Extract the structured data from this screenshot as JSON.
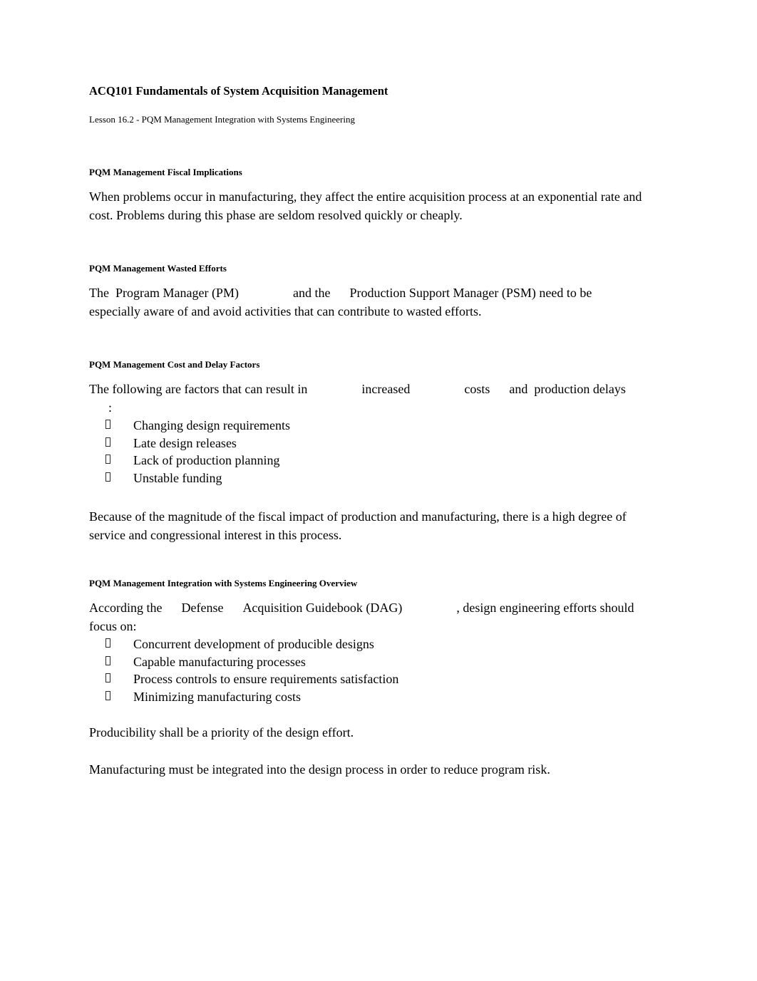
{
  "document": {
    "title": "ACQ101 Fundamentals of System Acquisition Management",
    "subtitle": "Lesson 16.2 - PQM Management Integration with Systems Engineering"
  },
  "sections": [
    {
      "heading": "PQM Management Fiscal Implications",
      "paragraph": "When problems occur in manufacturing, they affect the entire acquisition process at an exponential rate and cost. Problems during this phase are seldom resolved quickly or cheaply."
    },
    {
      "heading": "PQM Management Wasted Efforts",
      "part1": "The  Program Manager (PM)",
      "part2": "and the",
      "part3": "Production Support Manager (PSM) need to be especially aware of and avoid activities that can contribute to wasted efforts."
    },
    {
      "heading": "PQM Management Cost and Delay Factors",
      "lead1": "The following are factors that can result in",
      "lead2": "increased",
      "lead3": "costs",
      "lead4": "and  production delays",
      "lead5": ":",
      "bullets": [
        "Changing design requirements",
        "Late design releases",
        "Lack of production planning",
        "Unstable funding"
      ],
      "closing": "Because of the magnitude of the fiscal impact of production and manufacturing, there is a high degree of service and congressional interest in this process."
    },
    {
      "heading": "PQM Management Integration with Systems Engineering Overview",
      "lead1": "According the",
      "lead2": "Defense",
      "lead3": "Acquisition Guidebook (DAG)",
      "lead4": ", design engineering efforts should focus on:",
      "bullets": [
        "Concurrent development of producible designs",
        "Capable manufacturing processes",
        "Process controls to ensure requirements satisfaction",
        "Minimizing manufacturing costs"
      ],
      "closing1": "Producibility shall be a priority of the design effort.",
      "closing2": "Manufacturing must be integrated into the design process in order to reduce program risk."
    }
  ]
}
